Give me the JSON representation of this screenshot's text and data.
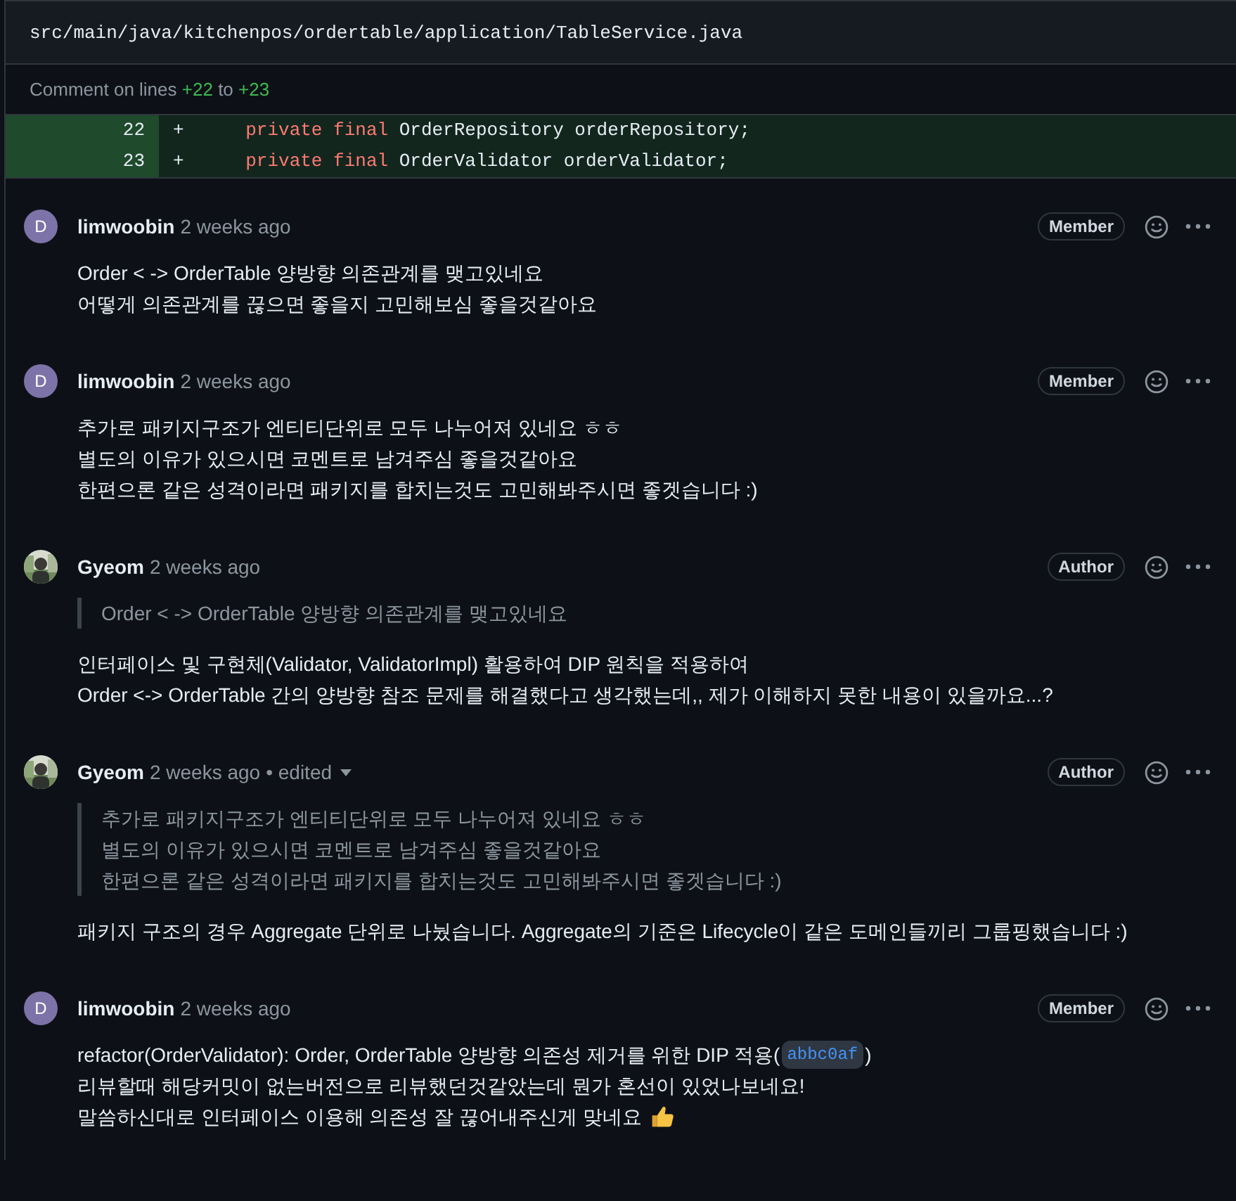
{
  "file_path": "src/main/java/kitchenpos/ordertable/application/TableService.java",
  "comment_range": {
    "prefix": "Comment on lines",
    "start": "+22",
    "joiner": "to",
    "end": "+23"
  },
  "diff_lines": [
    {
      "number": "22",
      "sign": "+",
      "keywords": "private final",
      "code": "OrderRepository orderRepository;"
    },
    {
      "number": "23",
      "sign": "+",
      "keywords": "private final",
      "code": "OrderValidator orderValidator;"
    }
  ],
  "comments": [
    {
      "avatar": {
        "kind": "letter",
        "letter": "D"
      },
      "author": "limwoobin",
      "time": "2 weeks ago",
      "badge": "Member",
      "body": [
        {
          "kind": "plain",
          "text": "Order < -> OrderTable 양방향 의존관계를 맺고있네요"
        },
        {
          "kind": "plain",
          "text": "어떻게 의존관계를 끊으면 좋을지 고민해보심 좋을것같아요"
        }
      ]
    },
    {
      "avatar": {
        "kind": "letter",
        "letter": "D"
      },
      "author": "limwoobin",
      "time": "2 weeks ago",
      "badge": "Member",
      "body": [
        {
          "kind": "plain",
          "text": "추가로 패키지구조가 엔티티단위로 모두 나누어져 있네요 ㅎㅎ"
        },
        {
          "kind": "plain",
          "text": "별도의 이유가 있으시면 코멘트로 남겨주심 좋을것같아요"
        },
        {
          "kind": "plain",
          "text": "한편으론 같은 성격이라면 패키지를 합치는것도 고민해봐주시면 좋겟습니다 :)"
        }
      ]
    },
    {
      "avatar": {
        "kind": "picture"
      },
      "author": "Gyeom",
      "time": "2 weeks ago",
      "badge": "Author",
      "quote": [
        "Order < -> OrderTable 양방향 의존관계를 맺고있네요"
      ],
      "body": [
        {
          "kind": "plain",
          "text": "인터페이스 및 구현체(Validator, ValidatorImpl) 활용하여 DIP 원칙을 적용하여"
        },
        {
          "kind": "plain",
          "text": "Order <-> OrderTable 간의 양방향 참조 문제를 해결했다고 생각했는데,, 제가 이해하지 못한 내용이 있을까요...?"
        }
      ]
    },
    {
      "avatar": {
        "kind": "picture"
      },
      "author": "Gyeom",
      "time": "2 weeks ago",
      "edited_label": "• edited",
      "badge": "Author",
      "quote": [
        "추가로 패키지구조가 엔티티단위로 모두 나누어져 있네요 ㅎㅎ",
        "별도의 이유가 있으시면 코멘트로 남겨주심 좋을것같아요",
        "한편으론 같은 성격이라면 패키지를 합치는것도 고민해봐주시면 좋겟습니다 :)"
      ],
      "body": [
        {
          "kind": "plain",
          "text": "패키지 구조의 경우 Aggregate 단위로 나눴습니다. Aggregate의 기준은 Lifecycle이 같은 도메인들끼리 그룹핑했습니다 :)"
        }
      ]
    },
    {
      "avatar": {
        "kind": "letter",
        "letter": "D"
      },
      "author": "limwoobin",
      "time": "2 weeks ago",
      "badge": "Member",
      "body": [
        {
          "kind": "commit",
          "text": "refactor(OrderValidator): Order, OrderTable 양방향 의존성 제거를 위한 DIP 적용(",
          "commit": "abbc0af",
          "after": ")"
        },
        {
          "kind": "plain",
          "text": "리뷰할때 해당커밋이 없는버전으로 리뷰했던것같았는데 뭔가 혼선이 있었나보네요!"
        },
        {
          "kind": "reaction",
          "text": "말씀하신대로 인터페이스 이용해 의존성 잘 끊어내주신게 맞네요"
        }
      ]
    }
  ]
}
